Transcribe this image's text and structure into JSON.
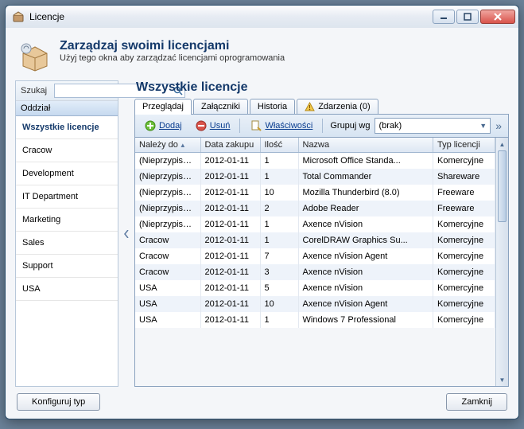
{
  "window": {
    "title": "Licencje"
  },
  "header": {
    "title": "Zarządzaj swoimi licencjami",
    "subtitle": "Użyj tego okna aby zarządzać licencjami oprogramowania"
  },
  "sidebar": {
    "search_label": "Szukaj",
    "search_value": "",
    "tree_header": "Oddział",
    "items": [
      {
        "label": "Wszystkie licencje",
        "selected": true
      },
      {
        "label": "Cracow"
      },
      {
        "label": "Development"
      },
      {
        "label": "IT Department"
      },
      {
        "label": "Marketing"
      },
      {
        "label": "Sales"
      },
      {
        "label": "Support"
      },
      {
        "label": "USA"
      }
    ]
  },
  "main": {
    "title": "Wszystkie licencje",
    "tabs": [
      {
        "label": "Przeglądaj",
        "active": true
      },
      {
        "label": "Załączniki"
      },
      {
        "label": "Historia"
      },
      {
        "label": "Zdarzenia (0)",
        "warn": true
      }
    ],
    "toolbar": {
      "add": "Dodaj",
      "remove": "Usuń",
      "properties": "Właściwości",
      "group_label": "Grupuj wg",
      "group_value": "(brak)"
    },
    "grid": {
      "columns": [
        {
          "label": "Należy do",
          "sort": "asc"
        },
        {
          "label": "Data zakupu"
        },
        {
          "label": "Ilość"
        },
        {
          "label": "Nazwa"
        },
        {
          "label": "Typ licencji"
        }
      ],
      "rows": [
        {
          "owner": "(Nieprzypisane)",
          "date": "2012-01-11",
          "qty": "1",
          "name": "Microsoft Office Standa...",
          "type": "Komercyjne"
        },
        {
          "owner": "(Nieprzypisane)",
          "date": "2012-01-11",
          "qty": "1",
          "name": "Total Commander",
          "type": "Shareware"
        },
        {
          "owner": "(Nieprzypisane)",
          "date": "2012-01-11",
          "qty": "10",
          "name": "Mozilla Thunderbird (8.0)",
          "type": "Freeware"
        },
        {
          "owner": "(Nieprzypisane)",
          "date": "2012-01-11",
          "qty": "2",
          "name": "Adobe Reader",
          "type": "Freeware"
        },
        {
          "owner": "(Nieprzypisane)",
          "date": "2012-01-11",
          "qty": "1",
          "name": "Axence nVision",
          "type": "Komercyjne"
        },
        {
          "owner": "Cracow",
          "date": "2012-01-11",
          "qty": "1",
          "name": "CorelDRAW Graphics Su...",
          "type": "Komercyjne"
        },
        {
          "owner": "Cracow",
          "date": "2012-01-11",
          "qty": "7",
          "name": "Axence nVision Agent",
          "type": "Komercyjne"
        },
        {
          "owner": "Cracow",
          "date": "2012-01-11",
          "qty": "3",
          "name": "Axence nVision",
          "type": "Komercyjne"
        },
        {
          "owner": "USA",
          "date": "2012-01-11",
          "qty": "5",
          "name": "Axence nVision",
          "type": "Komercyjne"
        },
        {
          "owner": "USA",
          "date": "2012-01-11",
          "qty": "10",
          "name": "Axence nVision Agent",
          "type": "Komercyjne"
        },
        {
          "owner": "USA",
          "date": "2012-01-11",
          "qty": "1",
          "name": "Windows 7 Professional",
          "type": "Komercyjne"
        }
      ]
    }
  },
  "footer": {
    "configure": "Konfiguruj typ",
    "close": "Zamknij"
  }
}
